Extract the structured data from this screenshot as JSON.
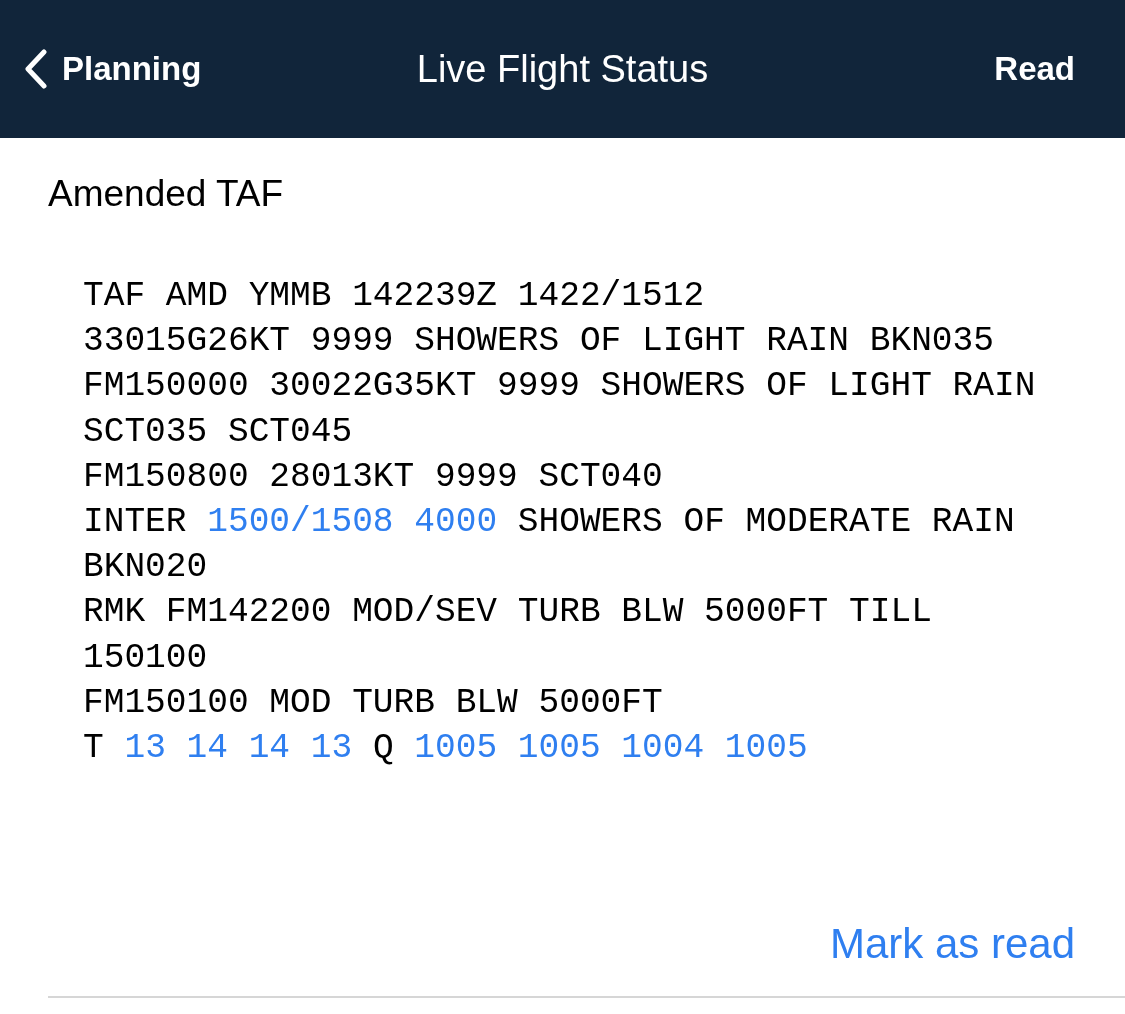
{
  "nav_bar": {
    "back_label": "Planning",
    "title": "Live Flight Status",
    "action": "Read"
  },
  "message": {
    "title": "Amended TAF",
    "lines": [
      [
        {
          "kind": "text",
          "text": "TAF AMD YMMB 142239Z 1422/1512"
        }
      ],
      [
        {
          "kind": "text",
          "text": "33015G26KT 9999 SHOWERS OF LIGHT RAIN BKN035"
        }
      ],
      [
        {
          "kind": "text",
          "text": "FM150000 30022G35KT 9999 SHOWERS OF LIGHT RAIN"
        }
      ],
      [
        {
          "kind": "text",
          "text": "SCT035 SCT045"
        }
      ],
      [
        {
          "kind": "text",
          "text": "FM150800 28013KT 9999 SCT040"
        }
      ],
      [
        {
          "kind": "text",
          "text": "INTER "
        },
        {
          "kind": "link",
          "text": "1500/1508 4000"
        },
        {
          "kind": "text",
          "text": " SHOWERS OF MODERATE RAIN"
        }
      ],
      [
        {
          "kind": "text",
          "text": "BKN020"
        }
      ],
      [
        {
          "kind": "text",
          "text": "RMK FM142200 MOD/SEV TURB BLW 5000FT TILL"
        }
      ],
      [
        {
          "kind": "text",
          "text": "150100"
        }
      ],
      [
        {
          "kind": "text",
          "text": "FM150100 MOD TURB BLW 5000FT"
        }
      ],
      [
        {
          "kind": "text",
          "text": "T "
        },
        {
          "kind": "link",
          "text": "13 14 14 13"
        },
        {
          "kind": "text",
          "text": " Q "
        },
        {
          "kind": "link",
          "text": "1005 1005 1004 1005"
        }
      ]
    ],
    "mark_read": "Mark as read"
  }
}
